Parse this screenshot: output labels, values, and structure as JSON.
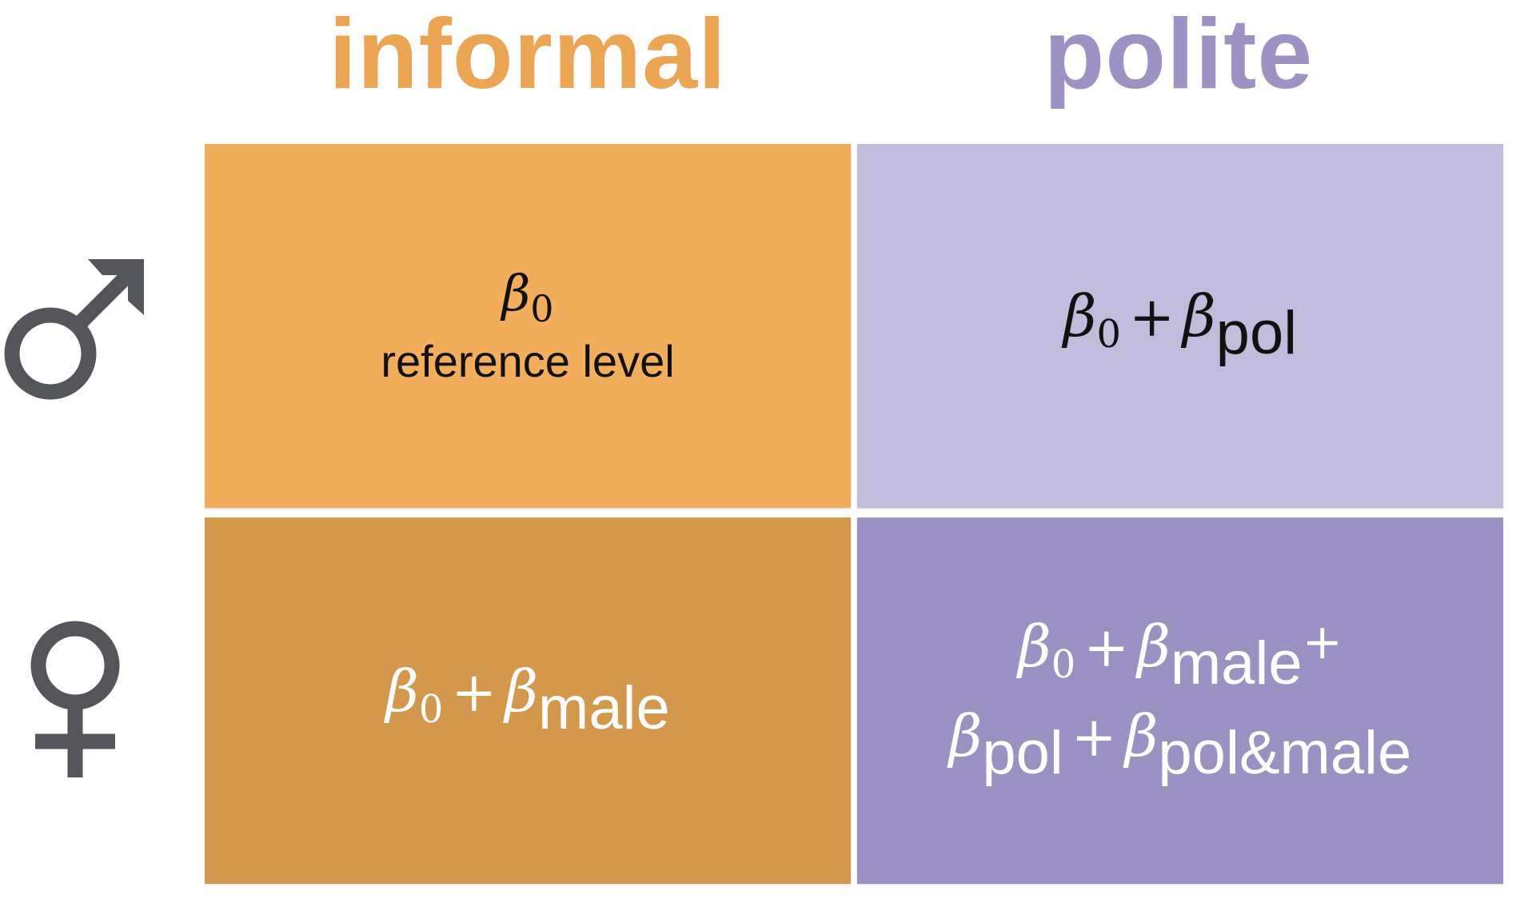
{
  "colors": {
    "informal_header": "#eca552",
    "polite_header": "#9d92c3",
    "cell_informal_male": "#f2ae5a",
    "cell_polite_male": "#c1bcdc",
    "cell_informal_female": "#d4984c",
    "cell_polite_female": "#9b92c3",
    "symbol": "#54565b"
  },
  "headers": {
    "informal": "informal",
    "polite": "polite"
  },
  "rows": [
    {
      "icon": "male-symbol-icon"
    },
    {
      "icon": "female-symbol-icon"
    }
  ],
  "cells": {
    "informal_male": {
      "beta": "β",
      "zero": "0",
      "note": "reference level"
    },
    "polite_male": {
      "beta1": "β",
      "zero": "0",
      "plus": "+",
      "beta2": "β",
      "sub": "pol"
    },
    "informal_female": {
      "beta1": "β",
      "zero": "0",
      "plus": "+",
      "beta2": "β",
      "sub": "male"
    },
    "polite_female": {
      "line1": {
        "beta1": "β",
        "zero": "0",
        "plus1": "+",
        "beta2": "β",
        "sub": "male",
        "plus2": "+"
      },
      "line2": {
        "beta1": "β",
        "sub1": "pol",
        "plus": "+",
        "beta2": "β",
        "sub2": "pol&male"
      }
    }
  }
}
